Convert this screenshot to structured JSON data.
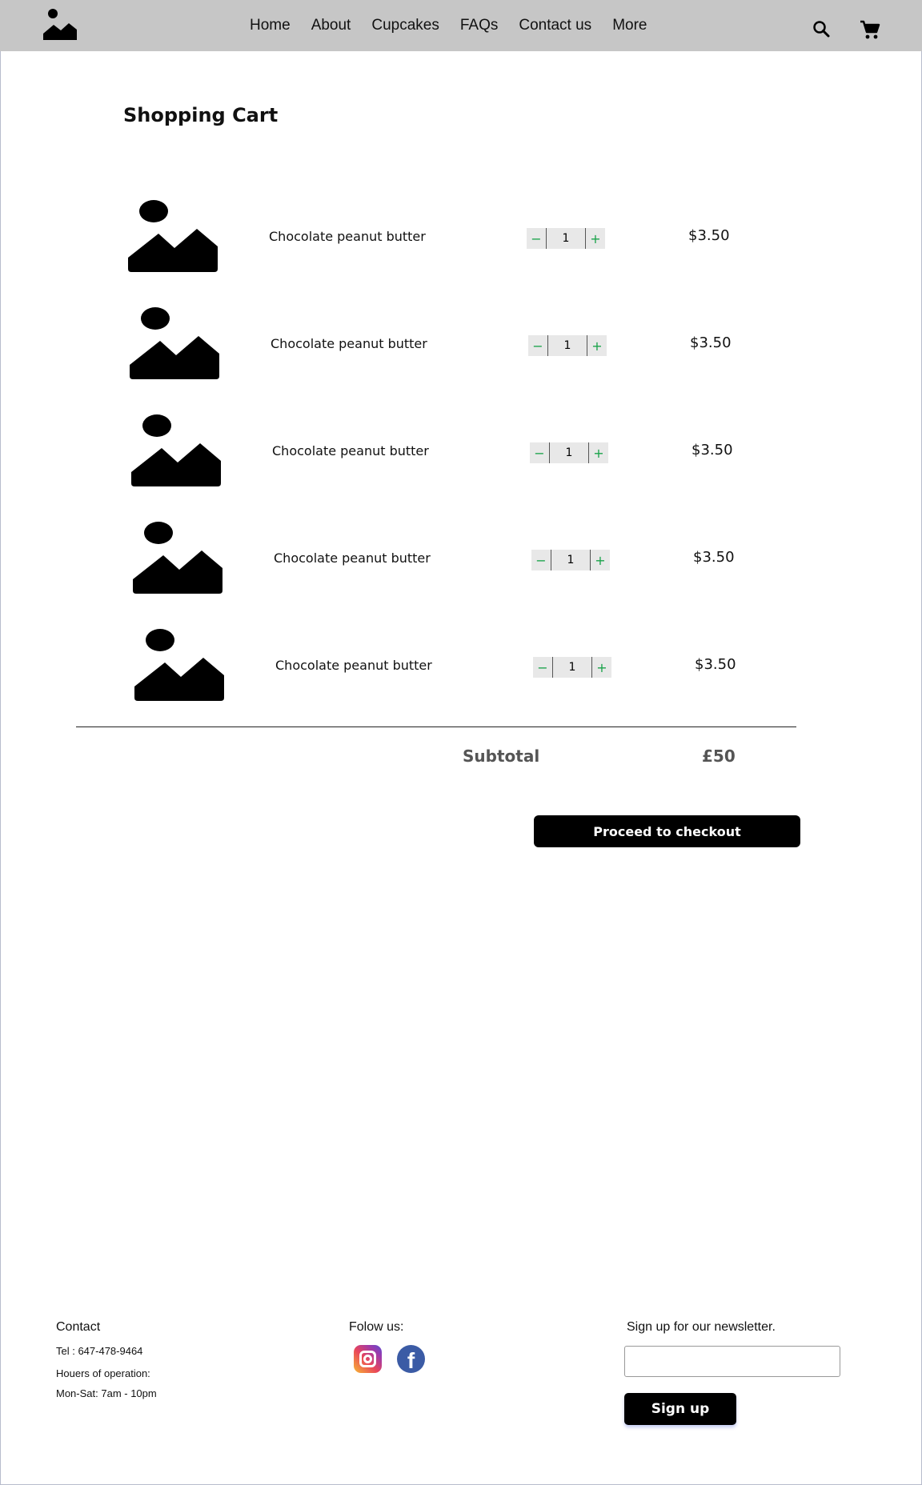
{
  "nav": {
    "items": [
      "Home",
      "About",
      "Cupcakes",
      "FAQs",
      "Contact us",
      "More"
    ],
    "search_icon": "search-icon",
    "cart_icon": "shopping-cart-icon",
    "logo_icon": "image-placeholder-icon"
  },
  "page": {
    "title": "Shopping Cart"
  },
  "cart": {
    "items": [
      {
        "name": "Chocolate peanut butter",
        "quantity": "1",
        "price": "$3.50",
        "decrement": "−",
        "increment": "+"
      },
      {
        "name": "Chocolate peanut butter",
        "quantity": "1",
        "price": "$3.50",
        "decrement": "−",
        "increment": "+"
      },
      {
        "name": "Chocolate peanut butter",
        "quantity": "1",
        "price": "$3.50",
        "decrement": "−",
        "increment": "+"
      },
      {
        "name": "Chocolate peanut butter",
        "quantity": "1",
        "price": "$3.50",
        "decrement": "−",
        "increment": "+"
      },
      {
        "name": "Chocolate peanut butter",
        "quantity": "1",
        "price": "$3.50",
        "decrement": "−",
        "increment": "+"
      }
    ],
    "subtotal_label": "Subtotal",
    "subtotal_value": "£50",
    "checkout_label": "Proceed to checkout"
  },
  "footer": {
    "contact": {
      "heading": "Contact",
      "tel": "Tel : 647-478-9464",
      "hours_label": "Houers of operation:",
      "hours": "Mon-Sat: 7am - 10pm"
    },
    "social": {
      "heading": "Folow us:",
      "icons": [
        "instagram-icon",
        "facebook-icon"
      ]
    },
    "newsletter": {
      "heading": "Sign up for our newsletter.",
      "input_value": "",
      "button_label": "Sign up"
    }
  },
  "colors": {
    "header_bg": "#c6c6c6",
    "stepper_accent": "#1aa34a",
    "button_bg": "#000000",
    "instagram": "#e9465a",
    "facebook": "#3b5ba5"
  }
}
